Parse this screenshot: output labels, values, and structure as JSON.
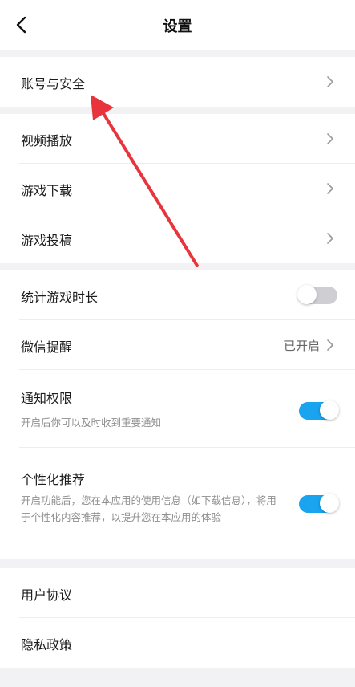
{
  "header": {
    "title": "设置"
  },
  "sections": {
    "account": {
      "account_security": "账号与安全"
    },
    "media": {
      "video_play": "视频播放",
      "game_download": "游戏下载",
      "game_submit": "游戏投稿"
    },
    "toggles": {
      "game_time": {
        "label": "统计游戏时长",
        "state": "off"
      },
      "wechat_reminder": {
        "label": "微信提醒",
        "value": "已开启"
      },
      "notification": {
        "label": "通知权限",
        "desc": "开启后你可以及时收到重要通知",
        "state": "on"
      },
      "personalized": {
        "label": "个性化推荐",
        "desc": "开启功能后，您在本应用的使用信息（如下载信息），将用于个性化内容推荐，以提升您在本应用的体验",
        "state": "on"
      }
    },
    "legal": {
      "user_agreement": "用户协议",
      "privacy_policy": "隐私政策"
    }
  },
  "colors": {
    "toggle_on": "#1aa3ee",
    "toggle_off": "#cfcfd3",
    "annotation_arrow": "#e8343c"
  }
}
